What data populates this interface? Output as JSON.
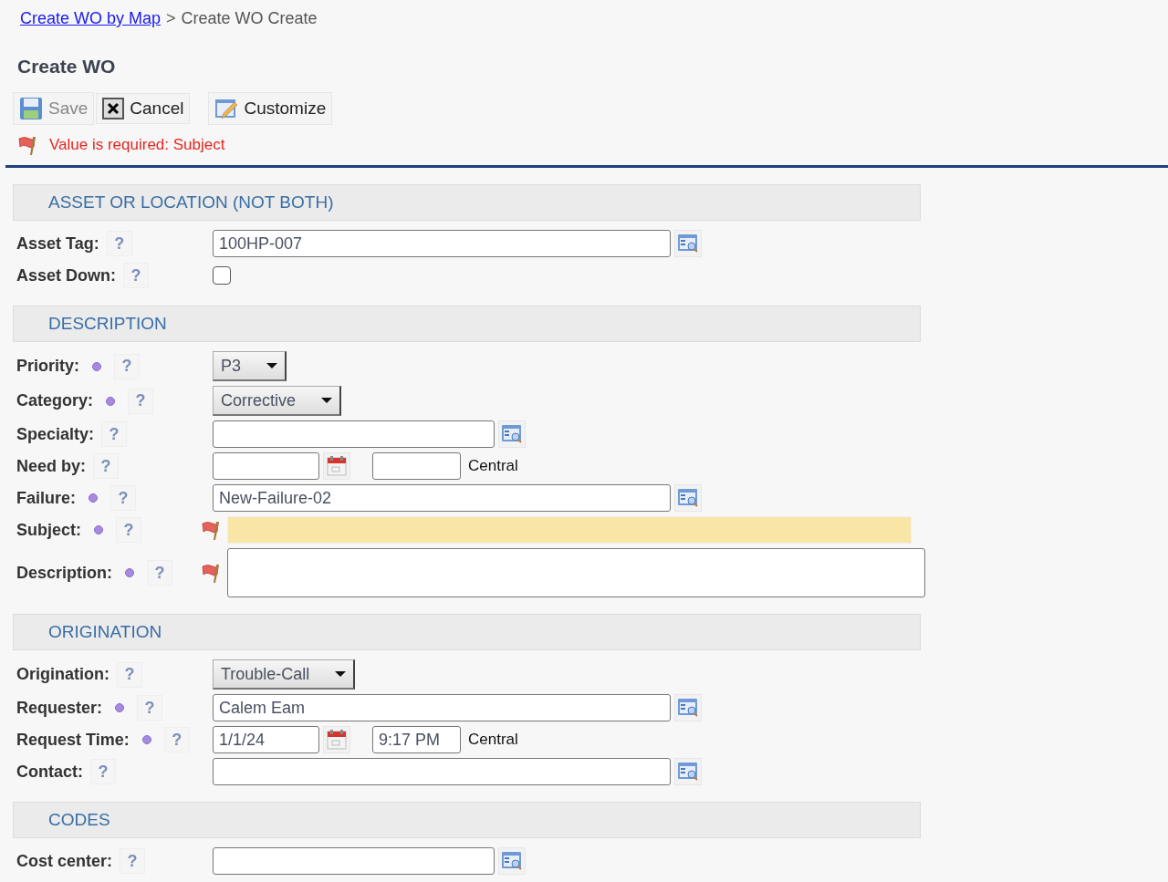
{
  "breadcrumb": {
    "link": "Create WO by Map",
    "separator": ">",
    "current": "Create WO Create"
  },
  "title": "Create WO",
  "toolbar": [
    {
      "kind": "save",
      "label": "Save",
      "disabled": true
    },
    {
      "kind": "cancel",
      "label": "Cancel",
      "disabled": false
    },
    {
      "kind": "customize",
      "label": "Customize",
      "disabled": false
    }
  ],
  "error": {
    "message": "Value is required: Subject"
  },
  "sections": [
    {
      "title": "ASSET OR LOCATION (NOT BOTH)",
      "fields": [
        {
          "label": "Asset Tag:",
          "help": "?",
          "required": false,
          "error": false,
          "kind": "lookup",
          "wide": true,
          "value": "100HP-007"
        },
        {
          "label": "Asset Down:",
          "help": "?",
          "required": false,
          "error": false,
          "kind": "checkbox",
          "checked": false
        }
      ]
    },
    {
      "title": "DESCRIPTION",
      "fields": [
        {
          "label": "Priority:",
          "help": "?",
          "required": true,
          "error": false,
          "kind": "select",
          "value": "P3"
        },
        {
          "label": "Category:",
          "help": "?",
          "required": true,
          "error": false,
          "kind": "select",
          "value": "Corrective"
        },
        {
          "label": "Specialty:",
          "help": "?",
          "required": false,
          "error": false,
          "kind": "lookup",
          "wide": false
        },
        {
          "label": "Need by:",
          "help": "?",
          "required": false,
          "error": false,
          "kind": "datetime",
          "zone": "Central"
        },
        {
          "label": "Failure:",
          "help": "?",
          "required": true,
          "error": false,
          "kind": "lookup",
          "wide": true,
          "value": "New-Failure-02"
        },
        {
          "label": "Subject:",
          "help": "?",
          "required": true,
          "error": true,
          "kind": "text"
        },
        {
          "label": "Description:",
          "help": "?",
          "required": true,
          "error": true,
          "kind": "textarea"
        }
      ]
    },
    {
      "title": "ORIGINATION",
      "fields": [
        {
          "label": "Origination:",
          "help": "?",
          "required": false,
          "error": false,
          "kind": "select",
          "value": "Trouble-Call"
        },
        {
          "label": "Requester:",
          "help": "?",
          "required": true,
          "error": false,
          "kind": "lookup",
          "wide": true,
          "value": "Calem Eam"
        },
        {
          "label": "Request Time:",
          "help": "?",
          "required": true,
          "error": false,
          "kind": "datetime",
          "date": "1/1/24",
          "time": "9:17 PM",
          "zone": "Central"
        },
        {
          "label": "Contact:",
          "help": "?",
          "required": false,
          "error": false,
          "kind": "lookup",
          "wide": true
        }
      ]
    },
    {
      "title": "CODES",
      "fields": [
        {
          "label": "Cost center:",
          "help": "?",
          "required": false,
          "error": false,
          "kind": "lookup",
          "wide": false
        }
      ]
    }
  ]
}
